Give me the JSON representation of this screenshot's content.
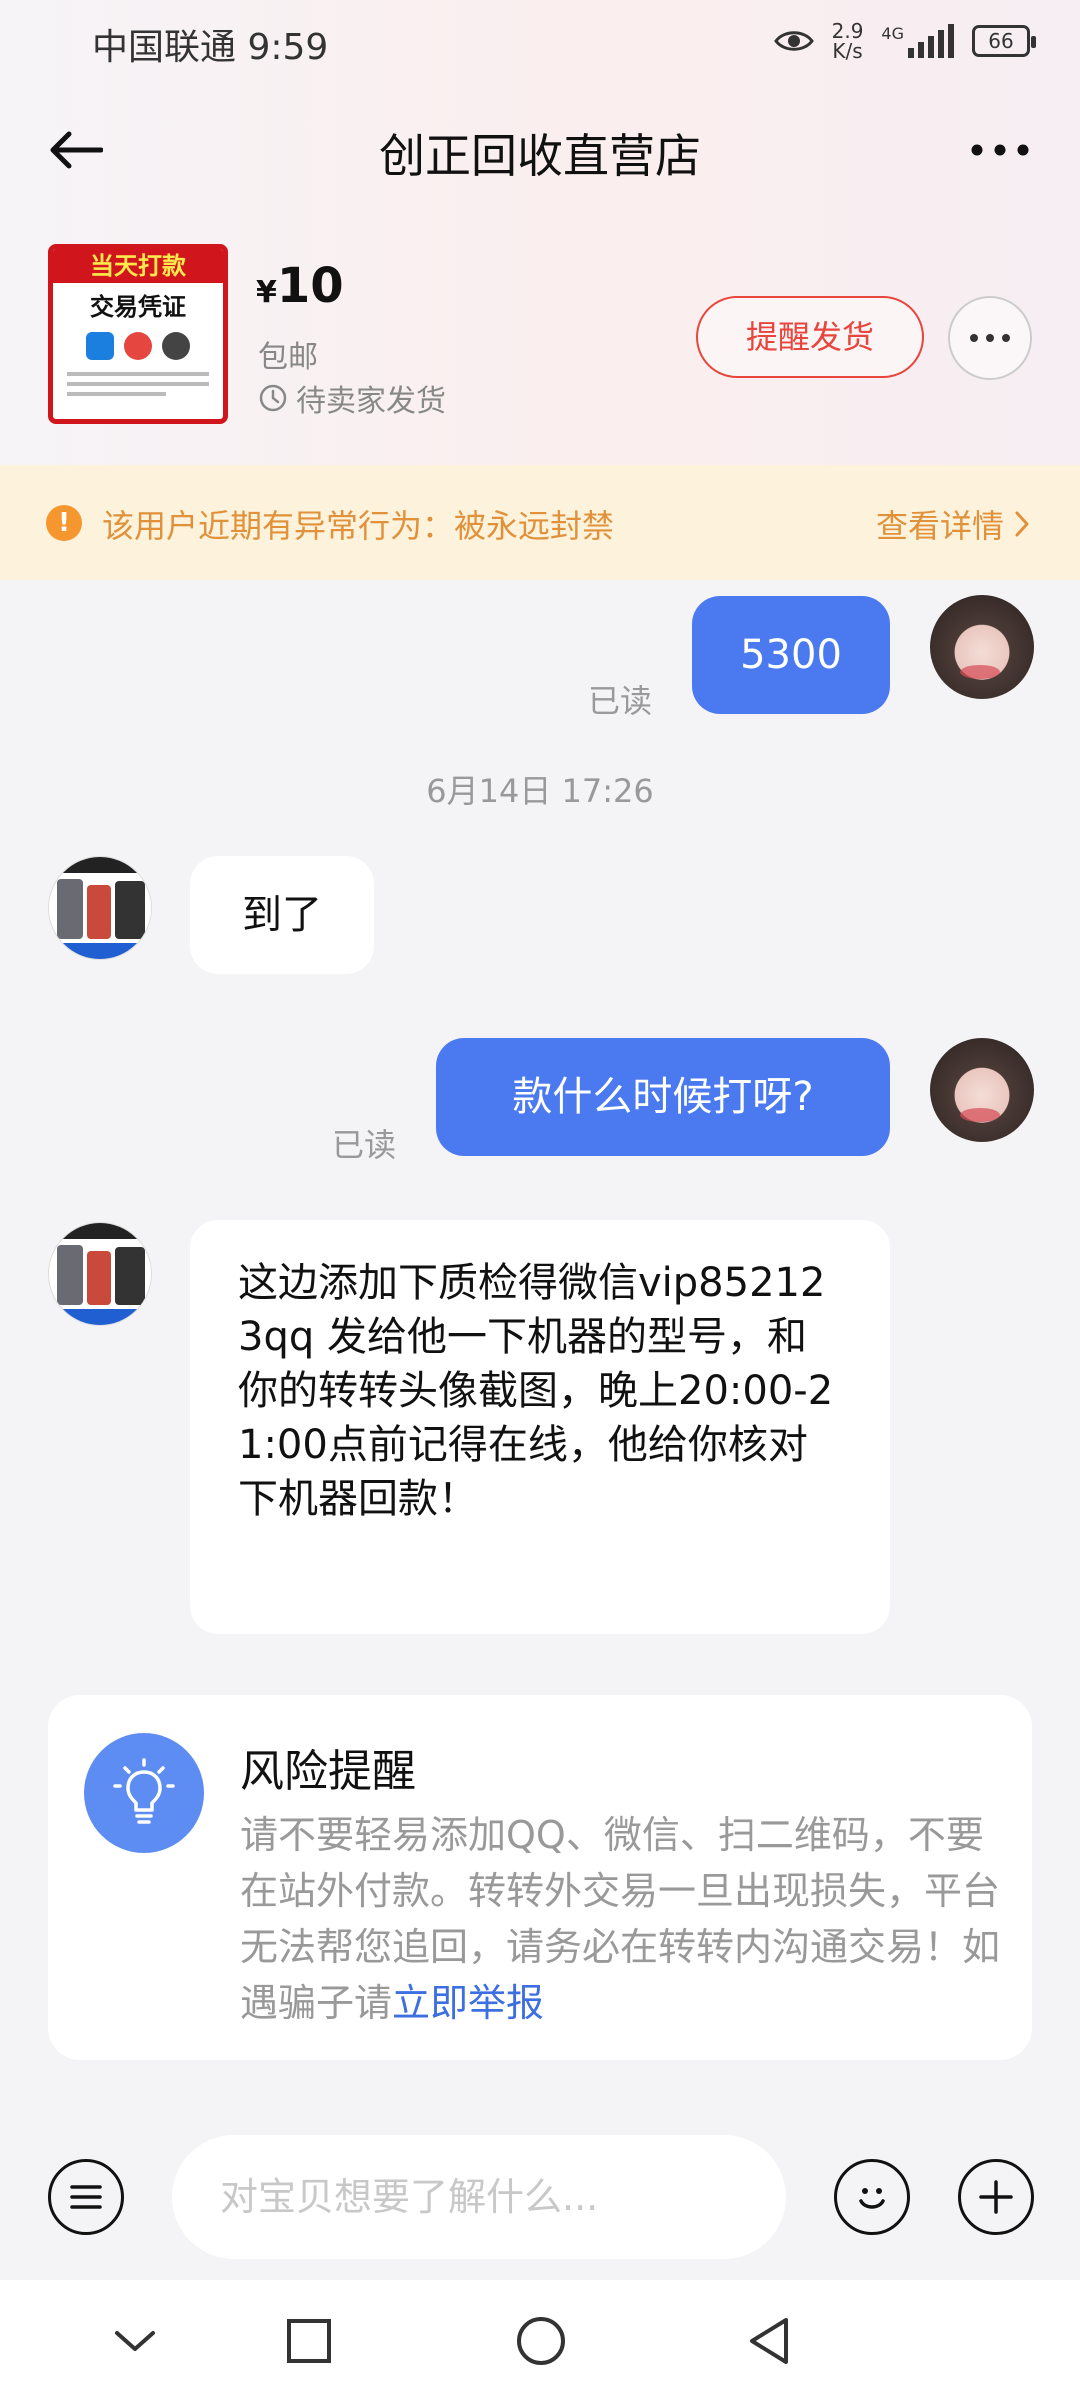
{
  "status_bar": {
    "carrier_time": "中国联通 9:59",
    "speed_value": "2.9",
    "speed_unit": "K/s",
    "network": "4G",
    "battery": "66"
  },
  "header": {
    "title": "创正回收直营店",
    "back_icon": "arrow-left-icon",
    "more_icon": "more-horizontal-icon"
  },
  "product": {
    "image_banner": "当天打款",
    "image_subtitle": "交易凭证",
    "currency": "¥",
    "price": "10",
    "shipping": "包邮",
    "status": "待卖家发货",
    "remind_button": "提醒发货",
    "accent_color": "#e8453c"
  },
  "warning": {
    "icon": "!",
    "text": "该用户近期有异常行为：被永远封禁",
    "link": "查看详情",
    "color": "#e0913a"
  },
  "messages": {
    "m1_text": "5300",
    "m1_read": "已读",
    "timestamp": "6月14日 17:26",
    "m2_text": "到了",
    "m3_text": "款什么时候打呀?",
    "m3_read": "已读",
    "m4_text": "这边添加下质检得微信vip852123qq 发给他一下机器的型号，和你的转转头像截图，晚上20:00-21:00点前记得在线，他给你核对下机器回款！",
    "bubble_color": "#4b7af0"
  },
  "risk": {
    "title": "风险提醒",
    "body": "请不要轻易添加QQ、微信、扫二维码，不要在站外付款。转转外交易一旦出现损失，平台无法帮您追回，请务必在转转内沟通交易！如遇骗子请",
    "link": "立即举报",
    "icon": "lightbulb-icon"
  },
  "input": {
    "placeholder": "对宝贝想要了解什么..."
  }
}
